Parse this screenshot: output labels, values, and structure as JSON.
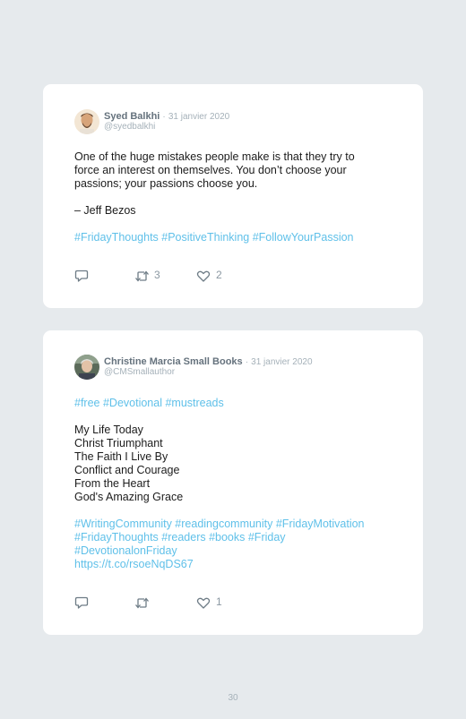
{
  "tweets": [
    {
      "author": "Syed Balkhi",
      "separator": "·",
      "date": "31 janvier 2020",
      "handle": "@syedbalkhi",
      "text_lines": [
        "One of the huge mistakes people make is that they try to",
        "force an interest on themselves. You don’t choose your",
        "passions; your passions choose you.",
        "",
        "– Jeff Bezos"
      ],
      "hashtags": "#FridayThoughts #PositiveThinking #FollowYourPassion",
      "retweets": "3",
      "likes": "2"
    },
    {
      "author": "Christine Marcia Small Books",
      "separator": "·",
      "date": "31 janvier 2020",
      "handle": "@CMSmallauthor",
      "hashtags_top": "#free #Devotional #mustreads",
      "text_lines": [
        "My Life Today",
        "Christ Triumphant",
        "The Faith I Live By",
        "Conflict and Courage",
        "From the Heart",
        "God's Amazing Grace"
      ],
      "hashtag_lines": [
        "#WritingCommunity #readingcommunity #FridayMotivation",
        "#FridayThoughts #readers #books #Friday",
        "#DevotionalonFriday",
        "https://t.co/rsoeNqDS67"
      ],
      "retweets": "",
      "likes": "1"
    }
  ],
  "icons": {
    "reply": "reply-icon",
    "retweet": "retweet-icon",
    "like": "heart-icon"
  },
  "colors": {
    "background": "#e6eaed",
    "card": "#ffffff",
    "hashtag": "#5fc0e9",
    "meta": "#a5b1b9"
  },
  "page_number": "30"
}
